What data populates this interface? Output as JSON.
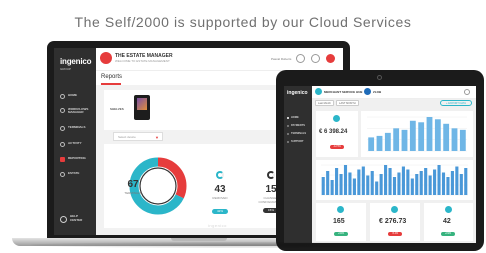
{
  "headline": "The Self/2000 is supported by our Cloud Services",
  "laptop": {
    "brand": {
      "logo": "ingenico",
      "tagline": "GROUP"
    },
    "sidebar": {
      "items": [
        {
          "label": "HOME",
          "icon": "home-icon"
        },
        {
          "label": "WORKFLOWS MANAGER",
          "icon": "workflow-icon"
        },
        {
          "label": "TERMINALS",
          "icon": "terminal-icon"
        },
        {
          "label": "ACTIVITY",
          "icon": "activity-icon"
        },
        {
          "label": "REPORTING",
          "icon": "report-icon",
          "active": true
        },
        {
          "label": "ESTATE",
          "icon": "estate-icon"
        }
      ],
      "help_label": "HELP CENTER"
    },
    "header": {
      "app_name": "THE ESTATE MANAGER",
      "app_subtitle": "WELCOME TO ESTATE MANAGEMENT",
      "welcome": "Pascal Roberts"
    },
    "tab": "Reports",
    "shop": {
      "label": "SHELVES"
    },
    "dropdown": {
      "value": "Select device"
    },
    "donut": {
      "value": "67",
      "label": "TERMINALS",
      "red_fraction": 0.32,
      "cyan_fraction": 0.68
    },
    "stats": [
      {
        "value": "43",
        "caption": "REMOVED",
        "pill": "42%",
        "color": "#2bb6c9"
      },
      {
        "value": "15",
        "caption": "CHANGED CONFIGURATION",
        "pill": "15%",
        "color": "#333333"
      }
    ],
    "footer_brand": "ingenico"
  },
  "tablet": {
    "brand": {
      "logo": "ingenico"
    },
    "header": {
      "app_name": "MERCHANT SERVICE HUB",
      "partner": "ZLOB"
    },
    "sidebar": {
      "items": [
        {
          "label": "HOME",
          "active": true
        },
        {
          "label": "PAYMENTS"
        },
        {
          "label": "TERMINALS"
        },
        {
          "label": "SUPPORT"
        }
      ]
    },
    "filters": {
      "range": "Last Month",
      "period": "LAST MONTH",
      "action": "+ EXPORT DATA"
    },
    "kpis": [
      {
        "value": "€ 6 398.24",
        "pill": "-12.5%",
        "pill_color": "#e63c3c"
      },
      {
        "value": "165",
        "pill": "+32%",
        "pill_color": "#36b37e"
      },
      {
        "value": "€ 276.73",
        "pill": "-5.4%",
        "pill_color": "#e63c3c"
      },
      {
        "value": "42",
        "pill": "+19%",
        "pill_color": "#36b37e"
      }
    ],
    "chart_top": [
      18,
      20,
      24,
      30,
      28,
      40,
      38,
      45,
      42,
      36,
      30,
      28
    ],
    "chart_mid": [
      12,
      16,
      10,
      18,
      14,
      20,
      15,
      11,
      17,
      19,
      13,
      16,
      9,
      14,
      20,
      18,
      12,
      15,
      19,
      17,
      11,
      14,
      16,
      18,
      13,
      17,
      20,
      15,
      12,
      16,
      19,
      14,
      18
    ]
  }
}
